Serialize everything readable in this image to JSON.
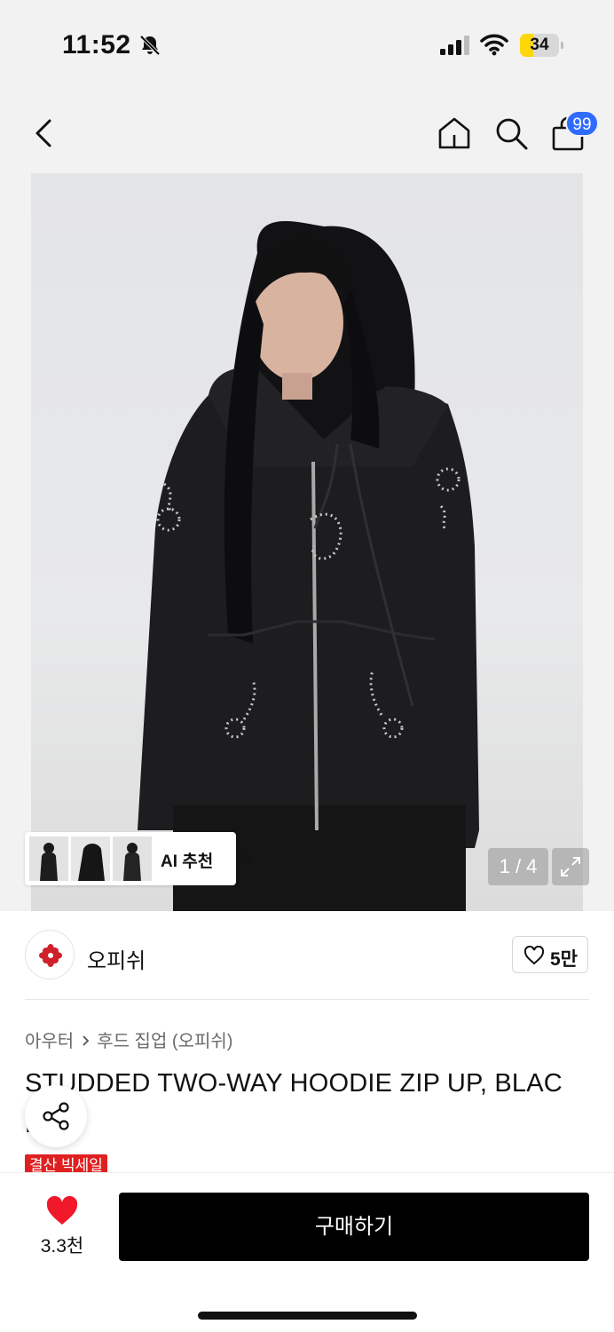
{
  "status_bar": {
    "time": "11:52",
    "battery_level": "34",
    "battery_fraction": 0.34,
    "battery_color": "#ffd60a",
    "icons": [
      "bell-off-icon",
      "signal-icon",
      "wifi-icon",
      "battery-icon"
    ]
  },
  "nav_bar": {
    "icons": [
      "back-chevron-icon",
      "home-icon",
      "search-icon",
      "shopping-bag-icon"
    ],
    "cart_badge": "99",
    "cart_badge_color": "#2f6bff"
  },
  "gallery": {
    "ai_recommend_label": "AI 추천",
    "page_counter": "1 / 4",
    "icons": [
      "chevron-right-icon",
      "expand-icon"
    ]
  },
  "brand": {
    "name": "오피쉬",
    "logo_icon": "flower-logo-icon",
    "logo_color": "#d0202a",
    "like_count": "5만"
  },
  "product": {
    "breadcrumb": [
      "아우터",
      "후드 집업 (오피쉬)"
    ],
    "title": "STUDDED TWO-WAY HOODIE ZIP UP, BLAC",
    "title_cont": "K",
    "sale_badge": "결산 빅세일",
    "sale_color": "#e02020"
  },
  "bottom_bar": {
    "wish_count": "3.3천",
    "wish_color": "#f0182a",
    "buy_label": "구매하기"
  }
}
